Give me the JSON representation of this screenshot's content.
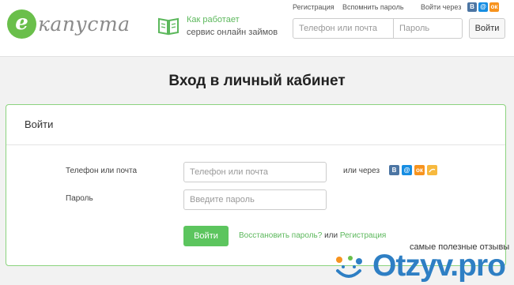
{
  "header": {
    "logo": {
      "mark": "е",
      "text": "капуста"
    },
    "how_it_works": {
      "title": "Как работает",
      "subtitle": "сервис онлайн займов"
    },
    "top_links": {
      "register": "Регистрация",
      "forgot": "Вспомнить пароль",
      "login_via": "Войти через"
    },
    "social": [
      {
        "icon": "vk-icon",
        "glyph": "В",
        "color": "#4c75a3"
      },
      {
        "icon": "mailru-icon",
        "glyph": "@",
        "color": "#168de2"
      },
      {
        "icon": "odnoklassniki-icon",
        "glyph": "ок",
        "color": "#f7931e"
      }
    ],
    "phone_placeholder": "Телефон или почта",
    "password_placeholder": "Пароль",
    "login_button": "Войти"
  },
  "page_title": "Вход в личный кабинет",
  "login_card": {
    "heading": "Войти",
    "phone_label": "Телефон или почта",
    "phone_placeholder": "Телефон или почта",
    "password_label": "Пароль",
    "password_placeholder": "Введите пароль",
    "or_via": "или через",
    "submit": "Войти",
    "restore_link": "Восстановить пароль?",
    "or": "или",
    "register_link": "Регистрация"
  },
  "watermark": {
    "tagline": "самые полезные отзывы",
    "logo": "Otzyv.pro"
  },
  "colors": {
    "accent_green": "#5cc55e",
    "link_green": "#5cb85c",
    "card_border": "#8bd37e"
  }
}
